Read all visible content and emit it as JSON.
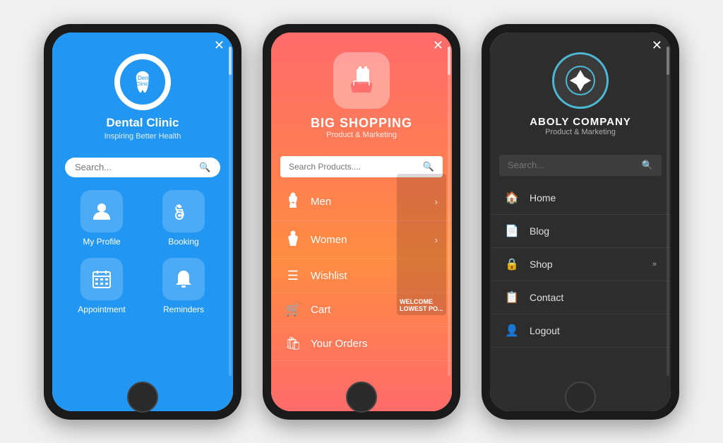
{
  "phones": {
    "dental": {
      "close_label": "✕",
      "app_name": "Dental Clinic",
      "tagline": "Inspiring Better Health",
      "search_placeholder": "Search...",
      "logo_icon": "🦷",
      "menu_items": [
        {
          "id": "my-profile",
          "label": "My Profile",
          "icon": "👤"
        },
        {
          "id": "booking",
          "label": "Booking",
          "icon": "🛒"
        },
        {
          "id": "appointment",
          "label": "Appointment",
          "icon": "📅"
        },
        {
          "id": "reminders",
          "label": "Reminders",
          "icon": "🔔"
        }
      ]
    },
    "shopping": {
      "close_label": "✕",
      "app_name": "BIG SHOPPING",
      "tagline": "Product & Marketing",
      "search_placeholder": "Search Products....",
      "logo_icon": "🛍",
      "menu_items": [
        {
          "id": "men",
          "label": "Men",
          "icon": "👔",
          "has_chevron": true
        },
        {
          "id": "women",
          "label": "Women",
          "icon": "👗",
          "has_chevron": true
        },
        {
          "id": "wishlist",
          "label": "Wishlist",
          "icon": "☰",
          "has_chevron": false
        },
        {
          "id": "cart",
          "label": "Cart",
          "icon": "🛒",
          "has_chevron": false
        },
        {
          "id": "your-orders",
          "label": "Your Orders",
          "icon": "🛍",
          "has_chevron": false
        }
      ]
    },
    "aboly": {
      "close_label": "✕",
      "app_name": "ABOLY COMPANY",
      "tagline": "Product & Marketing",
      "search_placeholder": "Search...",
      "logo_icon": "✦",
      "menu_items": [
        {
          "id": "home",
          "label": "Home",
          "icon": "🏠",
          "has_chevron": false
        },
        {
          "id": "blog",
          "label": "Blog",
          "icon": "📄",
          "has_chevron": false
        },
        {
          "id": "shop",
          "label": "Shop",
          "icon": "🔒",
          "has_chevron": true
        },
        {
          "id": "contact",
          "label": "Contact",
          "icon": "📋",
          "has_chevron": false
        },
        {
          "id": "logout",
          "label": "Logout",
          "icon": "👤",
          "has_chevron": false
        }
      ]
    }
  }
}
